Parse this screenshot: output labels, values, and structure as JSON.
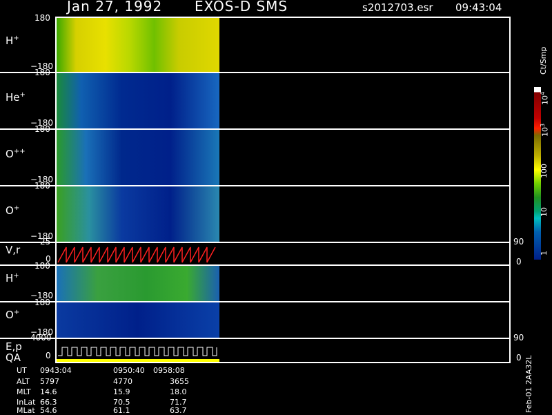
{
  "header": {
    "date": "Jan 27, 1992",
    "instrument": "EXOS-D SMS",
    "file": "s2012703.esr",
    "time": "09:43:04"
  },
  "panels": [
    {
      "label": "H",
      "sup": "+",
      "top_tick": "180",
      "bottom_tick": "−180"
    },
    {
      "label": "He",
      "sup": "+",
      "top_tick": "180",
      "bottom_tick": "−180"
    },
    {
      "label": "O",
      "sup": "++",
      "top_tick": "180",
      "bottom_tick": "−180"
    },
    {
      "label": "O",
      "sup": "+",
      "top_tick": "180",
      "bottom_tick": "−180"
    },
    {
      "label": "V,r",
      "sup": "",
      "top_tick": "25",
      "bottom_tick": "0",
      "right_top": "90",
      "right_bottom": "0"
    },
    {
      "label": "H",
      "sup": "+",
      "top_tick": "180",
      "bottom_tick": "−180"
    },
    {
      "label": "O",
      "sup": "+",
      "top_tick": "180",
      "bottom_tick": "−180"
    },
    {
      "label": "E,p",
      "sup": "",
      "top_tick": "4000",
      "bottom_tick": "0",
      "right_top": "90",
      "right_bottom": "0"
    }
  ],
  "qa_label": "QA",
  "colorbar": {
    "title": "Ct/Smp",
    "tick_labels": [
      "10",
      "4",
      "10",
      "3",
      "100",
      "10",
      "1"
    ]
  },
  "side_label": "Feb-01  2AA32L",
  "footer": {
    "rows": [
      {
        "name": "UT",
        "values": [
          "0943:04",
          "0950:40",
          "0958:08"
        ]
      },
      {
        "name": "ALT",
        "values": [
          "5797",
          "4770",
          "3655"
        ]
      },
      {
        "name": "MLT",
        "values": [
          "14.6",
          "15.9",
          "18.0"
        ]
      },
      {
        "name": "InLat",
        "values": [
          "66.3",
          "70.5",
          "71.7"
        ]
      },
      {
        "name": "MLat",
        "values": [
          "54.6",
          "61.1",
          "63.7"
        ]
      }
    ]
  },
  "colors": {
    "background": "#000000",
    "axis": "#ffffff",
    "trace_red": "#ff2020",
    "qa_yellow": "#ffff00"
  }
}
